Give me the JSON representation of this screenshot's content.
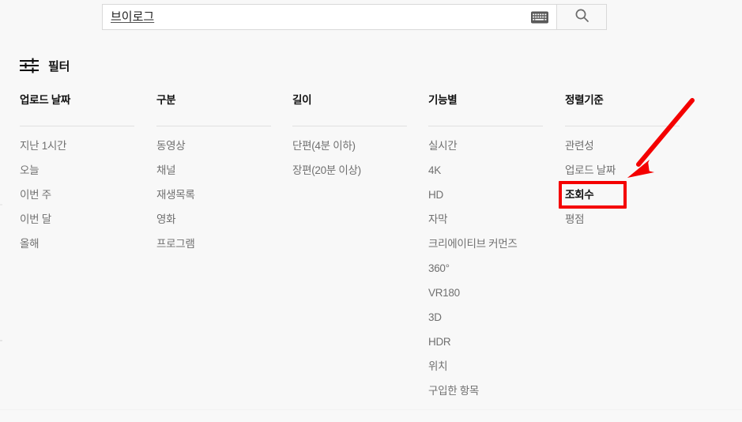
{
  "search": {
    "query": "브이로그",
    "placeholder": "검색",
    "keyboard_icon": "keyboard-icon",
    "search_icon": "search-icon"
  },
  "filter_header": {
    "icon": "tune-filter-icon",
    "label": "필터"
  },
  "columns": [
    {
      "key": "upload_date",
      "title": "업로드 날짜",
      "items": [
        {
          "label": "지난 1시간",
          "selected": false
        },
        {
          "label": "오늘",
          "selected": false
        },
        {
          "label": "이번 주",
          "selected": false
        },
        {
          "label": "이번 달",
          "selected": false
        },
        {
          "label": "올해",
          "selected": false
        }
      ]
    },
    {
      "key": "type",
      "title": "구분",
      "items": [
        {
          "label": "동영상",
          "selected": false
        },
        {
          "label": "채널",
          "selected": false
        },
        {
          "label": "재생목록",
          "selected": false
        },
        {
          "label": "영화",
          "selected": false
        },
        {
          "label": "프로그램",
          "selected": false
        }
      ]
    },
    {
      "key": "duration",
      "title": "길이",
      "items": [
        {
          "label": "단편(4분 이하)",
          "selected": false
        },
        {
          "label": "장편(20분 이상)",
          "selected": false
        }
      ]
    },
    {
      "key": "features",
      "title": "기능별",
      "items": [
        {
          "label": "실시간",
          "selected": false
        },
        {
          "label": "4K",
          "selected": false
        },
        {
          "label": "HD",
          "selected": false
        },
        {
          "label": "자막",
          "selected": false
        },
        {
          "label": "크리에이티브 커먼즈",
          "selected": false
        },
        {
          "label": "360°",
          "selected": false
        },
        {
          "label": "VR180",
          "selected": false
        },
        {
          "label": "3D",
          "selected": false
        },
        {
          "label": "HDR",
          "selected": false
        },
        {
          "label": "위치",
          "selected": false
        },
        {
          "label": "구입한 항목",
          "selected": false
        }
      ]
    },
    {
      "key": "sort_by",
      "title": "정렬기준",
      "items": [
        {
          "label": "관련성",
          "selected": false
        },
        {
          "label": "업로드 날짜",
          "selected": false
        },
        {
          "label": "조회수",
          "selected": true
        },
        {
          "label": "평점",
          "selected": false
        }
      ]
    }
  ],
  "annotation": {
    "highlight_target": "조회수",
    "color": "#f40000",
    "arrow": "red-arrow-annotation",
    "box": "red-highlight-box"
  },
  "colors": {
    "background": "#f8f8f8",
    "text_muted": "#707070",
    "text_strong": "#111111",
    "rule": "#e0e0e0",
    "field_border": "#d9d9d9",
    "annotation_red": "#f40000"
  }
}
